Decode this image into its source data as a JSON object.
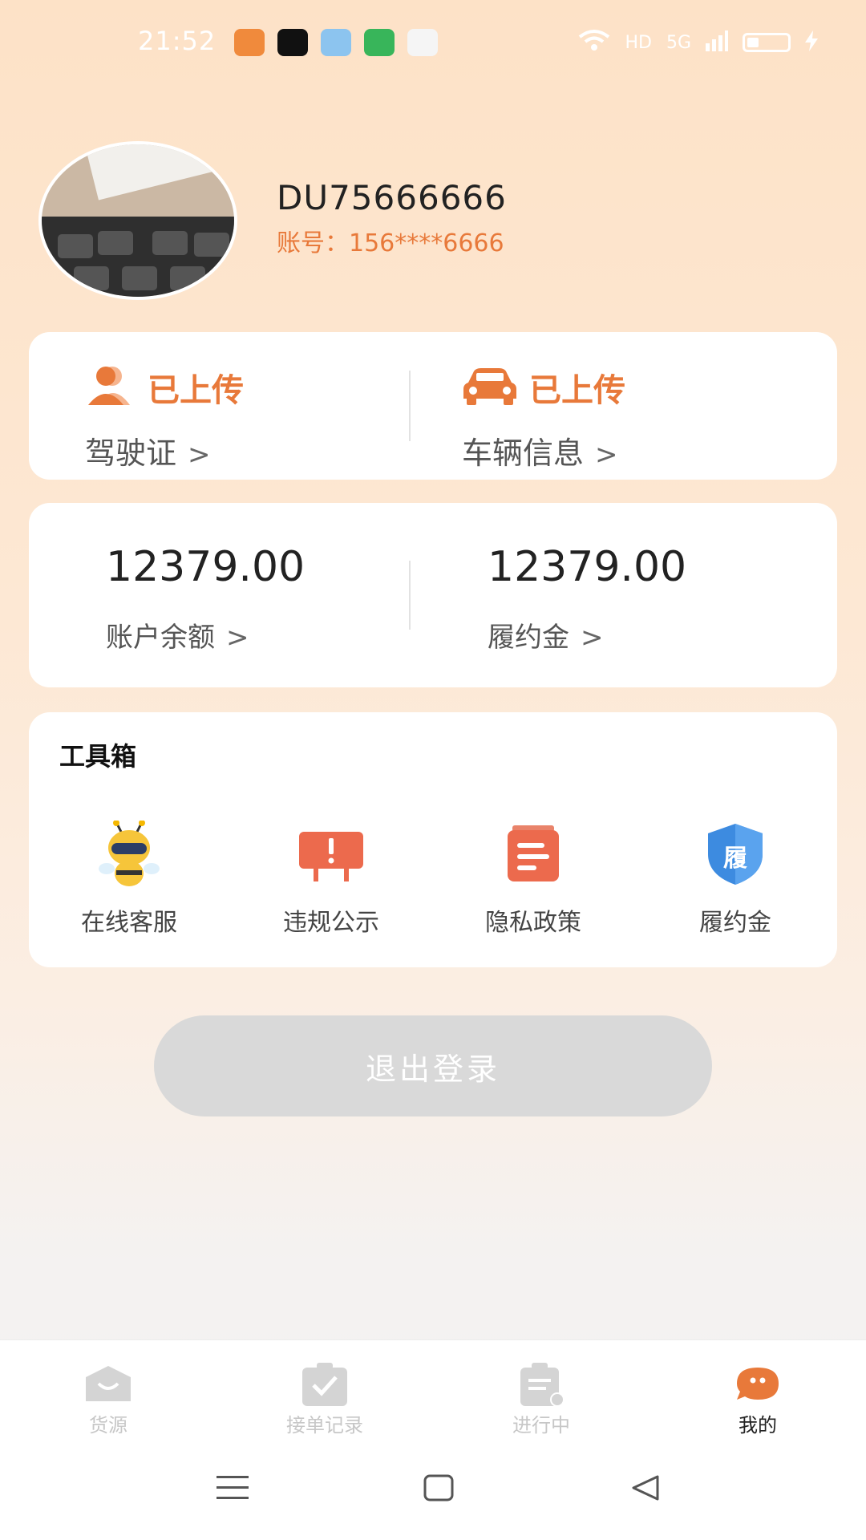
{
  "status_bar": {
    "time": "21:52",
    "network": "5G",
    "hd": "HD"
  },
  "profile": {
    "username": "DU75666666",
    "account_label": "账号：156****6666"
  },
  "uploads": [
    {
      "status": "已上传",
      "label": "驾驶证",
      "icon": "person-icon"
    },
    {
      "status": "已上传",
      "label": "车辆信息",
      "icon": "car-icon"
    }
  ],
  "finance": [
    {
      "value": "12379.00",
      "label": "账户余额"
    },
    {
      "value": "12379.00",
      "label": "履约金"
    }
  ],
  "toolbox": {
    "title": "工具箱",
    "items": [
      {
        "label": "在线客服",
        "icon": "bee-support-icon"
      },
      {
        "label": "违规公示",
        "icon": "alert-sign-icon"
      },
      {
        "label": "隐私政策",
        "icon": "document-icon"
      },
      {
        "label": "履约金",
        "icon": "shield-icon",
        "badge": "履"
      }
    ]
  },
  "logout_label": "退出登录",
  "tabs": [
    {
      "label": "货源",
      "active": false
    },
    {
      "label": "接单记录",
      "active": false
    },
    {
      "label": "进行中",
      "active": false
    },
    {
      "label": "我的",
      "active": true
    }
  ],
  "colors": {
    "accent": "#e8793a",
    "inactive": "#c7c7c7",
    "logout_bg": "#d9d9d9",
    "shield": "#3d8be0"
  }
}
